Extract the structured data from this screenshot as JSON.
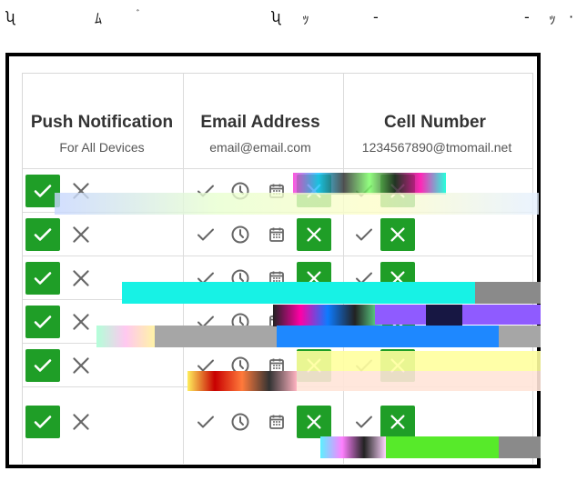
{
  "header_fragments": [
    "ʯ",
    "ﾑ",
    "ﾞ",
    "ʯ",
    "ｯ",
    "-",
    "-",
    "ｯ",
    "·"
  ],
  "columns": [
    {
      "title": "Push Notification",
      "subtitle": "For All Devices"
    },
    {
      "title": "Email Address",
      "subtitle": "email@email.com"
    },
    {
      "title": "Cell Number",
      "subtitle": "1234567890@tmomail.net"
    }
  ],
  "rows": 6,
  "colors": {
    "green": "#1f9e27",
    "border": "#000000",
    "gridline": "#dcdcdc",
    "icon_gray": "#666666"
  },
  "icons": [
    "check-icon",
    "x-icon",
    "clock-icon",
    "calendar-icon"
  ]
}
